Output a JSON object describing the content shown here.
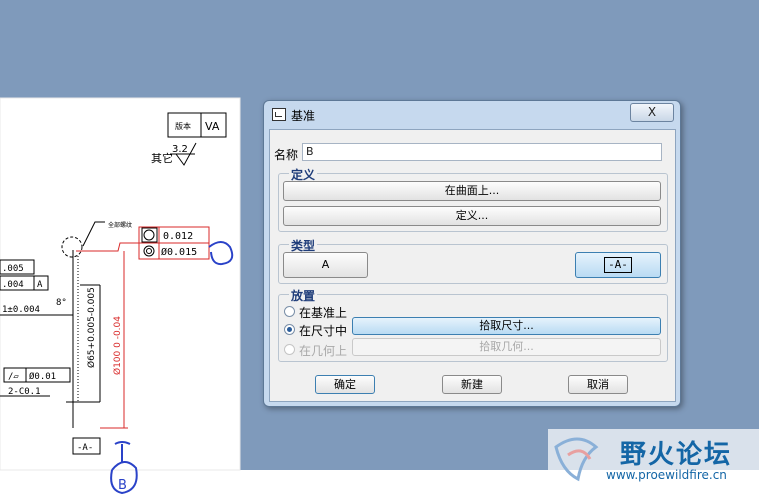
{
  "dialog": {
    "title": "基准",
    "close_label": "X",
    "name_label": "名称",
    "name_value": "B",
    "definition": {
      "title": "定义",
      "on_surface_button": "在曲面上...",
      "define_button": "定义..."
    },
    "type": {
      "title": "类型",
      "a_button": "A",
      "datum_button": "-A-"
    },
    "placement": {
      "title": "放置",
      "options": [
        {
          "label": "在基准上",
          "selected": false,
          "enabled": true
        },
        {
          "label": "在尺寸中",
          "selected": true,
          "enabled": true
        },
        {
          "label": "在几何上",
          "selected": false,
          "enabled": false
        }
      ],
      "pick_dimension_button": "拾取尺寸...",
      "pick_geometry_button": "拾取几何..."
    },
    "ok_button": "确定",
    "new_button": "新建",
    "cancel_button": "取消"
  },
  "drawing": {
    "version_label": "版本",
    "version_value": "VA",
    "roughness_value": "3.2",
    "other_label": "其它",
    "tol_values": [
      "0.012",
      "Ø0.015"
    ],
    "dim_values": [
      ".005",
      ".004",
      "A",
      "1±0.004",
      "8°",
      "Ø0.01",
      "2-C0.1",
      "-A-"
    ],
    "dim_vertical_1": "Ø65+0.005-0.005",
    "dim_vertical_2": "Ø100 0 -0.04",
    "handwritten_label": "B",
    "note_label": "全部螺纹"
  },
  "watermark": {
    "site_name": "野火论坛",
    "url": "www.proewildfire.cn"
  }
}
